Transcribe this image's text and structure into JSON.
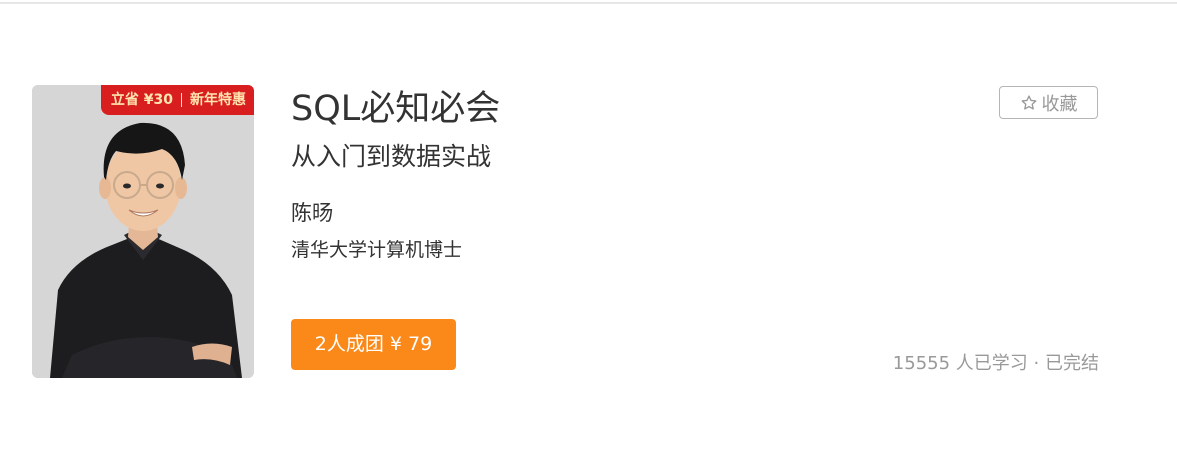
{
  "course": {
    "title": "SQL必知必会",
    "subtitle": "从入门到数据实战",
    "promo": {
      "left": "立省 ¥30",
      "right": "新年特惠"
    }
  },
  "author": {
    "name": "陈旸",
    "title": "清华大学计算机博士"
  },
  "actions": {
    "group_buy_label": "2人成团 ¥ 79",
    "favorite_label": "收藏"
  },
  "stats": {
    "learners": "15555",
    "learners_suffix": "人已学习",
    "separator": "·",
    "status": "已完结"
  },
  "colors": {
    "accent": "#fa8919",
    "promo_bg": "#d81e1e",
    "promo_text": "#ffe6b0",
    "muted_text": "#999999",
    "primary_text": "#333333"
  },
  "icons": {
    "favorite": "star-outline-icon"
  }
}
